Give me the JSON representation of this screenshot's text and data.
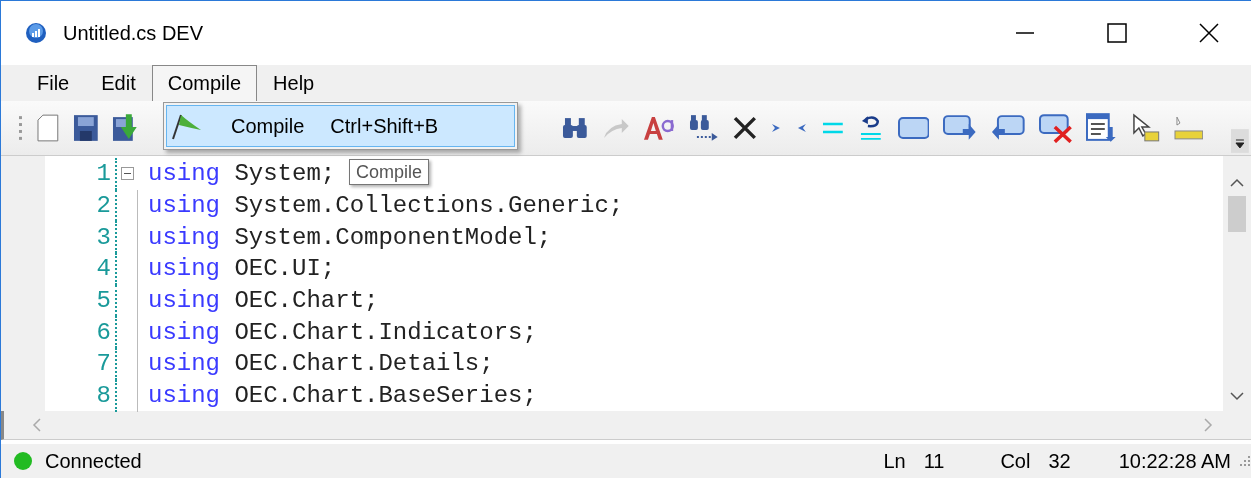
{
  "window": {
    "title": "Untitled.cs DEV"
  },
  "menu": [
    {
      "label": "File",
      "selected": false
    },
    {
      "label": "Edit",
      "selected": false
    },
    {
      "label": "Compile",
      "selected": true
    },
    {
      "label": "Help",
      "selected": false
    }
  ],
  "dropdown": [
    {
      "label": "Compile",
      "shortcut": "Ctrl+Shift+B",
      "selected": true
    }
  ],
  "tooltip": "Compile",
  "editor": {
    "lines": [
      {
        "number": "1",
        "keyword": "using",
        "text": "System;",
        "folded": false
      },
      {
        "number": "2",
        "keyword": "using",
        "text": "System.Collections.Generic;"
      },
      {
        "number": "3",
        "keyword": "using",
        "text": "System.ComponentModel;"
      },
      {
        "number": "4",
        "keyword": "using",
        "text": "OEC.UI;"
      },
      {
        "number": "5",
        "keyword": "using",
        "text": "OEC.Chart;"
      },
      {
        "number": "6",
        "keyword": "using",
        "text": "OEC.Chart.Indicators;"
      },
      {
        "number": "7",
        "keyword": "using",
        "text": "OEC.Chart.Details;"
      },
      {
        "number": "8",
        "keyword": "using",
        "text": "OEC.Chart.BaseSeries;"
      }
    ]
  },
  "status_bar": {
    "connection": {
      "label": "Connected",
      "color": "#22bb22"
    },
    "line": {
      "label": "Ln",
      "value": "11"
    },
    "column": {
      "label": "Col",
      "value": "32"
    },
    "time": "10:22:28 AM"
  }
}
